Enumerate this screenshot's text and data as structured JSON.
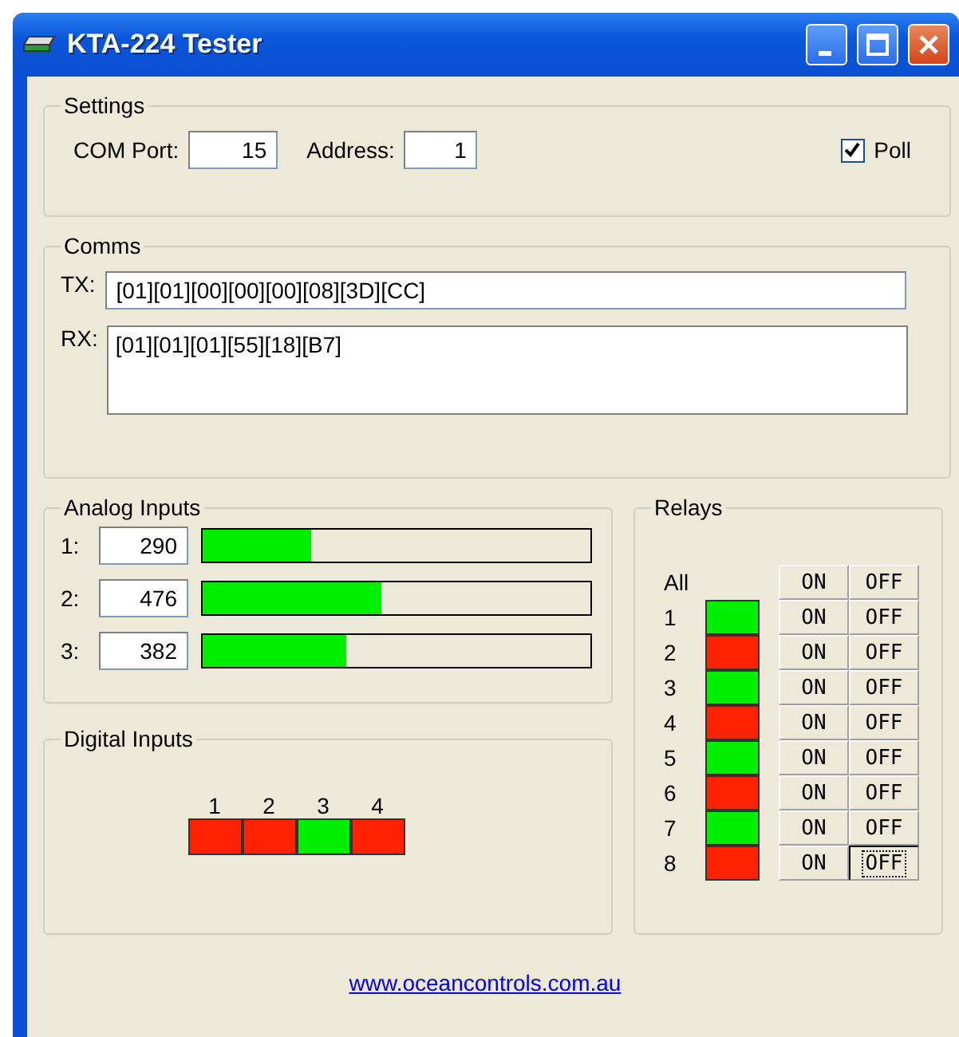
{
  "window": {
    "title": "KTA-224 Tester"
  },
  "settings": {
    "title": "Settings",
    "com_port_label": "COM Port:",
    "com_port": "15",
    "address_label": "Address:",
    "address": "1",
    "poll_label": "Poll",
    "poll_checked": true
  },
  "comms": {
    "title": "Comms",
    "tx_label": "TX:",
    "tx": "[01][01][00][00][00][08][3D][CC]",
    "rx_label": "RX:",
    "rx": "[01][01][01][55][18][B7]"
  },
  "analog_inputs": {
    "title": "Analog Inputs",
    "channels": [
      {
        "label": "1:",
        "value": "290",
        "level": 0.28
      },
      {
        "label": "2:",
        "value": "476",
        "level": 0.46
      },
      {
        "label": "3:",
        "value": "382",
        "level": 0.37
      }
    ]
  },
  "digital_inputs": {
    "title": "Digital Inputs",
    "inputs": [
      {
        "label": "1",
        "on": false
      },
      {
        "label": "2",
        "on": false
      },
      {
        "label": "3",
        "on": true
      },
      {
        "label": "4",
        "on": false
      }
    ]
  },
  "relays": {
    "title": "Relays",
    "all": {
      "label": "All",
      "on_button": "ON",
      "off_button": "OFF"
    },
    "rows": [
      {
        "label": "1",
        "on": true,
        "on_button": "ON",
        "off_button": "OFF",
        "off_focused": false
      },
      {
        "label": "2",
        "on": false,
        "on_button": "ON",
        "off_button": "OFF",
        "off_focused": false
      },
      {
        "label": "3",
        "on": true,
        "on_button": "ON",
        "off_button": "OFF",
        "off_focused": false
      },
      {
        "label": "4",
        "on": false,
        "on_button": "ON",
        "off_button": "OFF",
        "off_focused": false
      },
      {
        "label": "5",
        "on": true,
        "on_button": "ON",
        "off_button": "OFF",
        "off_focused": false
      },
      {
        "label": "6",
        "on": false,
        "on_button": "ON",
        "off_button": "OFF",
        "off_focused": false
      },
      {
        "label": "7",
        "on": true,
        "on_button": "ON",
        "off_button": "OFF",
        "off_focused": false
      },
      {
        "label": "8",
        "on": false,
        "on_button": "ON",
        "off_button": "OFF",
        "off_focused": true
      }
    ]
  },
  "link": "www.oceancontrols.com.au"
}
